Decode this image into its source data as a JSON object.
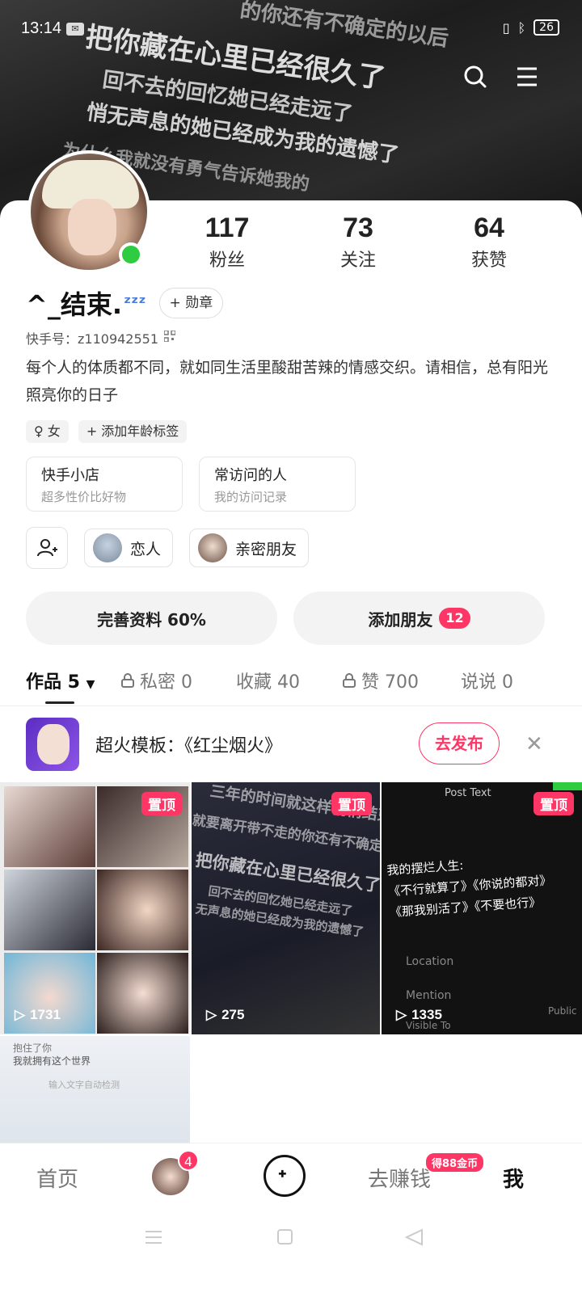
{
  "status": {
    "time": "13:14",
    "battery": "26"
  },
  "banner": {
    "line1": "把你藏在心里已经很久了",
    "line1b": "的你还有不确定的以后",
    "line2": "回不去的回忆她已经走远了",
    "line3": "悄无声息的她已经成为我的遗憾了",
    "line4": "为什么我就没有勇气告诉她我的"
  },
  "profile": {
    "followers": "117",
    "followers_label": "粉丝",
    "following": "73",
    "following_label": "关注",
    "likes": "64",
    "likes_label": "获赞",
    "username": "^_结束.",
    "zzz": "ᶻᶻᶻ",
    "badge_button": "+ 勋章",
    "uid": "快手号：z110942551",
    "bio": "每个人的体质都不同，就如同生活里酸甜苦辣的情感交织。请相信，总有阳光照亮你的日子",
    "tags": [
      "♀ 女",
      "+ 添加年龄标签"
    ]
  },
  "cards": [
    {
      "title": "快手小店",
      "sub": "超多性价比好物"
    },
    {
      "title": "常访问的人",
      "sub": "我的访问记录"
    }
  ],
  "relations": [
    "恋人",
    "亲密朋友"
  ],
  "actions": {
    "complete": "完善资料 60%",
    "add_friend": "添加朋友",
    "add_friend_count": "12"
  },
  "tabs": {
    "works": "作品 5",
    "private": "私密 0",
    "favorites": "收藏 40",
    "liked": "赞 700",
    "posts": "说说 0"
  },
  "promo": {
    "text": "超火模板：《红尘烟火》",
    "button": "去发布"
  },
  "grid": {
    "pin_label": "置顶",
    "item1_plays": "1731",
    "item2_plays": "275",
    "item3_plays": "1335",
    "item2_text": [
      "三年的时间就这样悄悄结束",
      "就要离开带不走的你还有不确定的",
      "把你藏在心里已经很久了",
      "回不去的回忆她已经走远了",
      "无声息的她已经成为我的遗憾了"
    ],
    "item3_title": "Post Text",
    "item3_body": "我的摆烂人生:\n《不行就算了》《你说的都对》\n《那我别活了》《不要也行》",
    "item3_location": "Location",
    "item3_mention": "Mention",
    "item3_visible": "Visible To",
    "item3_public": "Public",
    "item4_line1": "抱住了你",
    "item4_line2": "我就拥有这个世界",
    "item4_hint": "输入文字自动检测"
  },
  "nav": {
    "home": "首页",
    "avatar_badge": "4",
    "earn": "去赚钱",
    "earn_badge": "得88金币",
    "me": "我"
  },
  "colors": {
    "accent": "#fe3666",
    "online": "#2ecc40"
  }
}
